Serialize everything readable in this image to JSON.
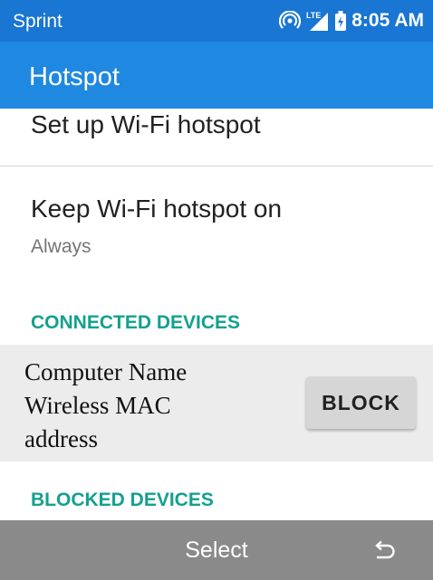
{
  "status_bar": {
    "carrier": "Sprint",
    "time": "8:05 AM",
    "icons": [
      "hotspot-icon",
      "lte-signal-icon",
      "battery-icon"
    ],
    "color": "#1976d2"
  },
  "app_bar": {
    "title": "Hotspot",
    "color": "#1f88e0"
  },
  "settings": {
    "setup_label": "Set up Wi-Fi hotspot",
    "keep_on_label": "Keep Wi-Fi hotspot on",
    "keep_on_value": "Always"
  },
  "connected": {
    "header": "CONNECTED DEVICES",
    "device_text": "Computer Name Wireless MAC address",
    "block_label": "BLOCK"
  },
  "blocked": {
    "header": "BLOCKED DEVICES"
  },
  "softkeys": {
    "center_label": "Select",
    "right_icon": "back-icon"
  },
  "accent_color": "#14a08f"
}
